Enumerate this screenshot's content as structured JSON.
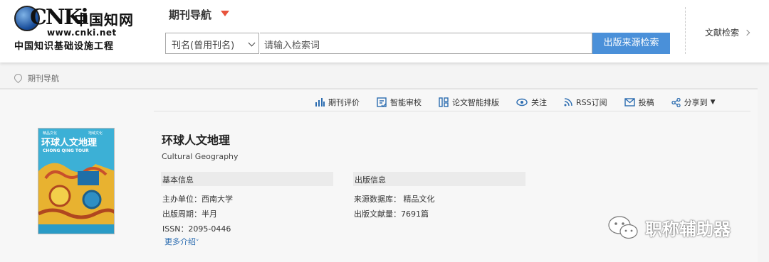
{
  "logo": {
    "brand": "CNKi",
    "brand_cn": "中国知网",
    "url": "www.cnki.net",
    "slogan": "中国知识基础设施工程"
  },
  "header": {
    "nav_title": "期刊导航",
    "search": {
      "field_selected": "刊名(曾用刊名)",
      "placeholder": "请输入检索词",
      "button_label": "出版来源检索"
    },
    "lit_search_label": "文献检索"
  },
  "breadcrumb": {
    "label": "期刊导航"
  },
  "toolbar": {
    "items": [
      {
        "label": "期刊评价",
        "icon": "bar-chart-icon"
      },
      {
        "label": "智能审校",
        "icon": "review-doc-icon"
      },
      {
        "label": "论文智能排版",
        "icon": "layout-icon"
      },
      {
        "label": "关注",
        "icon": "eye-icon"
      },
      {
        "label": "RSS订阅",
        "icon": "rss-icon"
      },
      {
        "label": "投稿",
        "icon": "mail-icon"
      },
      {
        "label": "分享到",
        "icon": "share-icon"
      }
    ]
  },
  "journal": {
    "title": "环球人文地理",
    "title_en": "Cultural Geography",
    "basic": {
      "heading": "基本信息",
      "sponsor": "主办单位：西南大学",
      "cycle": "出版周期：半月",
      "issn": "ISSN：2095-0446",
      "more": "更多介绍"
    },
    "publication": {
      "heading": "出版信息",
      "source_db": "来源数据库：  精品文化",
      "count": "出版文献量：7691篇"
    },
    "cover": {
      "title_cn": "环球人文地理",
      "title_en": "CHONG QING TOUR",
      "top_left": "精品文化",
      "top_right": "地域文化"
    }
  },
  "watermark": {
    "text": "职称辅助器"
  },
  "colors": {
    "accent": "#4a90d9",
    "caret": "#e8533c",
    "link": "#2b6cb0"
  }
}
